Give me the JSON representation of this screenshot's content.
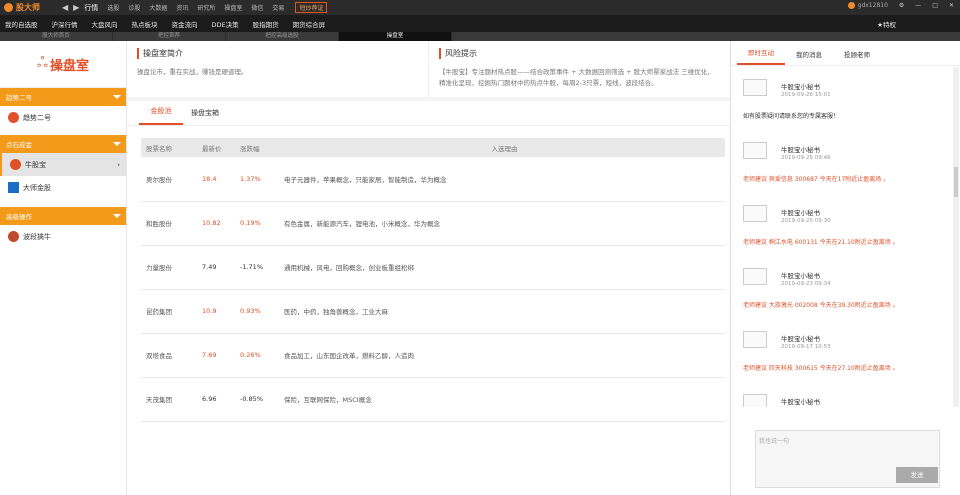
{
  "app": {
    "name": "股大师"
  },
  "topmenu": [
    "行情",
    "选股",
    "诊股",
    "大数据",
    "资讯",
    "研究所",
    "操盘室",
    "微信",
    "交易"
  ],
  "top_badge": "短炒荐证",
  "user": {
    "name": "gdx12810"
  },
  "subnav": [
    "我的自选股",
    "沪深行情",
    "大盘风向",
    "热点板块",
    "资金流向",
    "DDE决策",
    "股指期货",
    "期货综合屏"
  ],
  "favorite": "★特权",
  "window_tabs": [
    "股大师首页",
    "把控首荐",
    "把控高级选股",
    "操盘室"
  ],
  "sidebar": {
    "brand": "操盘室",
    "groups": [
      {
        "title": "趋势二号",
        "items": [
          {
            "label": "趋势二号",
            "icon_color": "#e2502a"
          }
        ]
      },
      {
        "title": "点石成金",
        "items": [
          {
            "label": "牛股宝",
            "icon_color": "#e2502a"
          },
          {
            "label": "大师金股",
            "icon_color": "#1a6fc4"
          }
        ]
      },
      {
        "title": "高级操作",
        "items": [
          {
            "label": "波段擒牛",
            "icon_color": "#c14a2e"
          }
        ]
      }
    ]
  },
  "intro": {
    "title": "操盘室简介",
    "text": "操盘论市，重在实战，赚钱是硬道理。",
    "risk_title": "风险提示",
    "risk_text": "【牛股宝】专注题材热点股——结合政策事件 + 大数据回测筛选 + 股大师票家战法 三维优化，精准化呈现，挖掘热门题材中的热点牛股，每周2-3只票，短线，波段结合。"
  },
  "panel": {
    "tabs": [
      "金股池",
      "操盘宝箱"
    ],
    "columns": [
      "股票名称",
      "最新价",
      "涨跌幅",
      "入选理由"
    ],
    "rows": [
      {
        "name": "奥尔股份",
        "price": "18.4",
        "change": "1.37%",
        "reason": "电子元器件，苹果概念，只能家居，智能制造，华为概念"
      },
      {
        "name": "和胜股份",
        "price": "10.82",
        "change": "0.19%",
        "reason": "有色金属，新能源汽车，锂电池，小米概念，华为概念"
      },
      {
        "name": "力量股份",
        "price": "7.49",
        "change": "-1.71%",
        "reason": "通用机械，风电，回购概念，创业板重组松绑"
      },
      {
        "name": "昆药集团",
        "price": "10.9",
        "change": "0.93%",
        "reason": "医药，中药，独角兽概念，工业大麻"
      },
      {
        "name": "双塔食品",
        "price": "7.69",
        "change": "0.26%",
        "reason": "食品加工，山东国企改革，燃料乙醇，人造肉"
      },
      {
        "name": "天茂集团",
        "price": "6.96",
        "change": "-0.85%",
        "reason": "保险，互联网保险，MSCI概念"
      }
    ]
  },
  "right": {
    "tabs": [
      "即时互动",
      "我的消息",
      "投顾老师"
    ],
    "messages": [
      {
        "name": "牛股宝小秘书",
        "time": "2019-09-26 15:01",
        "text": "如有股票疑问请联系您的专属客服！",
        "style": "black"
      },
      {
        "name": "牛股宝小秘书",
        "time": "2019-09-25 09:46",
        "text": "老师建议 爽爱信息 300687 今天在17附近止盈离场 。",
        "style": "red"
      },
      {
        "name": "牛股宝小秘书",
        "time": "2019-09-25 09:30",
        "text": "老师建议 桐江水电 600131 今天在21.10附近止盈离场 。",
        "style": "red"
      },
      {
        "name": "牛股宝小秘书",
        "time": "2019-09-23 09:34",
        "text": "老师建议 大族激光 002008 今天在39.30附近止盈离场 。",
        "style": "red"
      },
      {
        "name": "牛股宝小秘书",
        "time": "2019-09-17 10:53",
        "text": "老师建议 欣天科技 300615 今天在27.10附近止盈离场 。",
        "style": "red"
      },
      {
        "name": "牛股宝小秘书",
        "time": "",
        "text": "",
        "style": "red"
      }
    ],
    "input_placeholder": "我也说一句",
    "send_label": "发送"
  }
}
